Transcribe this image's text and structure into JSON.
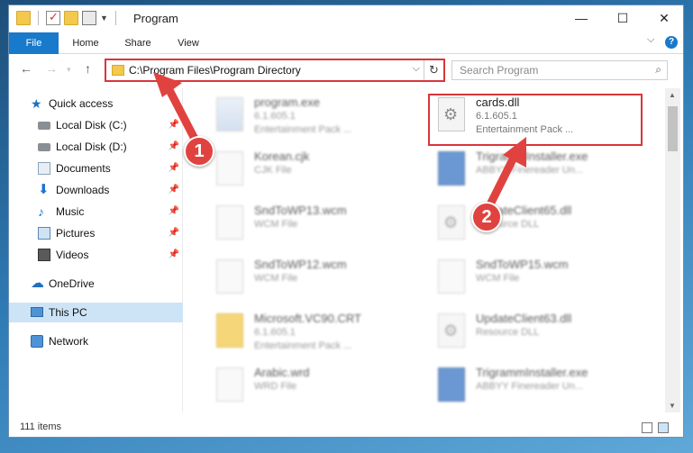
{
  "window": {
    "title": "Program",
    "controls": {
      "minimize": "—",
      "maximize": "☐",
      "close": "✕"
    }
  },
  "ribbon": {
    "tabs": [
      "File",
      "Home",
      "Share",
      "View"
    ],
    "help": "?"
  },
  "nav": {
    "address_path": "C:\\Program Files\\Program Directory",
    "search_placeholder": "Search Program"
  },
  "sidebar": {
    "items": [
      {
        "label": "Quick access",
        "icon": "star-icon"
      },
      {
        "label": "Local Disk (C:)",
        "icon": "drive-icon",
        "pinned": true
      },
      {
        "label": "Local Disk (D:)",
        "icon": "drive-icon",
        "pinned": true
      },
      {
        "label": "Documents",
        "icon": "documents-icon",
        "pinned": true
      },
      {
        "label": "Downloads",
        "icon": "download-icon",
        "pinned": true
      },
      {
        "label": "Music",
        "icon": "music-icon",
        "pinned": true
      },
      {
        "label": "Pictures",
        "icon": "pictures-icon",
        "pinned": true
      },
      {
        "label": "Videos",
        "icon": "videos-icon",
        "pinned": true
      },
      {
        "label": "OneDrive",
        "icon": "cloud-icon"
      },
      {
        "label": "This PC",
        "icon": "pc-icon",
        "selected": true
      },
      {
        "label": "Network",
        "icon": "network-icon"
      }
    ]
  },
  "files": [
    {
      "name": "program.exe",
      "type": "6.1.605.1",
      "desc": "Entertainment Pack ...",
      "icon": "exe-icon"
    },
    {
      "name": "cards.dll",
      "type": "6.1.605.1",
      "desc": "Entertainment Pack ...",
      "icon": "dll-icon"
    },
    {
      "name": "Korean.cjk",
      "type": "CJK File",
      "desc": "",
      "icon": "file-icon"
    },
    {
      "name": "TrigrammInstaller.exe",
      "type": "ABBYY Finereader Un...",
      "desc": "",
      "icon": "app-icon"
    },
    {
      "name": "SndToWP13.wcm",
      "type": "WCM File",
      "desc": "",
      "icon": "file-icon"
    },
    {
      "name": "UpdateClient65.dll",
      "type": "Resource DLL",
      "desc": "",
      "icon": "dll-icon"
    },
    {
      "name": "SndToWP12.wcm",
      "type": "WCM File",
      "desc": "",
      "icon": "file-icon"
    },
    {
      "name": "SndToWP15.wcm",
      "type": "WCM File",
      "desc": "",
      "icon": "file-icon"
    },
    {
      "name": "Microsoft.VC90.CRT",
      "type": "6.1.605.1",
      "desc": "Entertainment Pack ...",
      "icon": "folder-icon"
    },
    {
      "name": "UpdateClient63.dll",
      "type": "Resource DLL",
      "desc": "",
      "icon": "dll-icon"
    },
    {
      "name": "Arabic.wrd",
      "type": "WRD File",
      "desc": "",
      "icon": "file-icon"
    },
    {
      "name": "TrigrammInstaller.exe",
      "type": "ABBYY Finereader Un...",
      "desc": "",
      "icon": "app-icon"
    }
  ],
  "status": {
    "item_count": "111 items"
  },
  "callouts": {
    "one": "1",
    "two": "2"
  },
  "colors": {
    "accent": "#1979ca",
    "highlight": "#d9353a",
    "selected": "#cde4f7"
  }
}
